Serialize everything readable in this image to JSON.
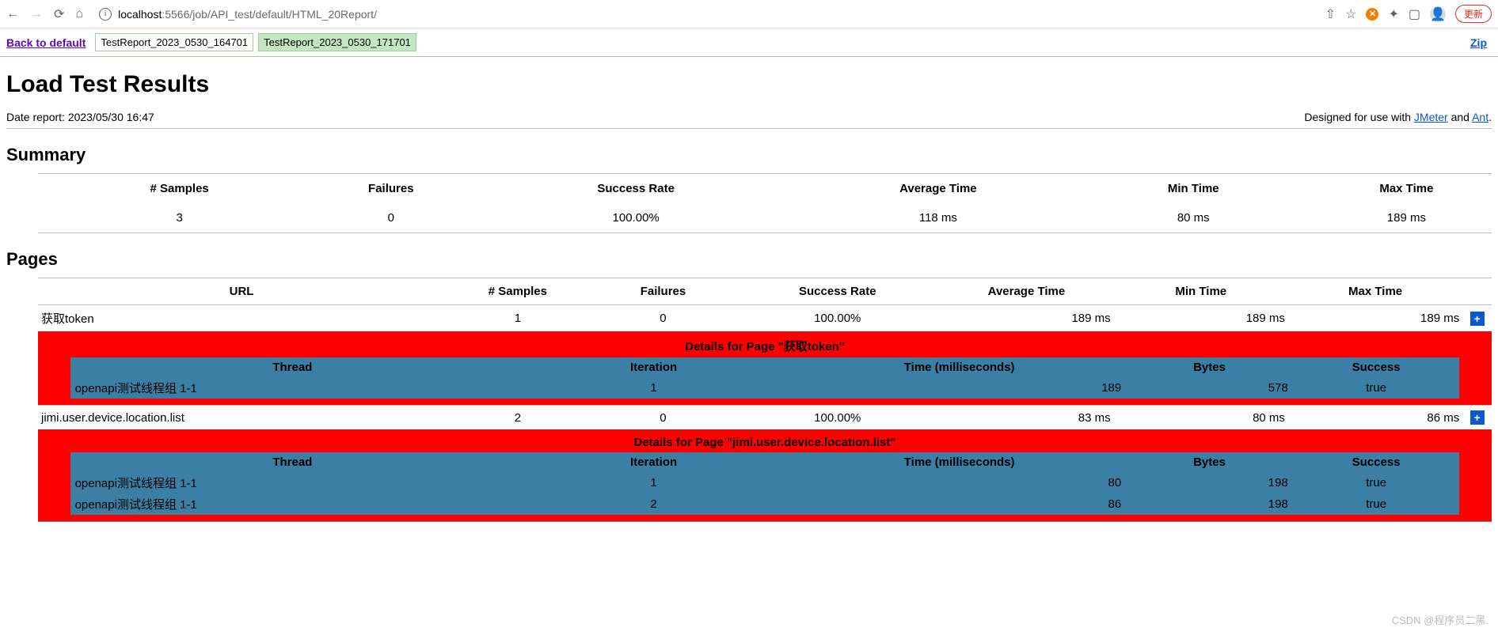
{
  "browser": {
    "url_host": "localhost",
    "url_port": ":5566",
    "url_path": "/job/API_test/default/HTML_20Report/",
    "update_btn": "更新"
  },
  "top": {
    "back": "Back to default",
    "tabs": [
      "TestReport_2023_0530_164701",
      "TestReport_2023_0530_171701"
    ],
    "zip": "Zip"
  },
  "title": "Load Test Results",
  "meta": {
    "date_label": "Date report: 2023/05/30 16:47",
    "designed_prefix": "Designed for use with ",
    "jmeter": "JMeter",
    "and": " and ",
    "ant": "Ant",
    "suffix": "."
  },
  "summary_heading": "Summary",
  "summary_headers": [
    "# Samples",
    "Failures",
    "Success Rate",
    "Average Time",
    "Min Time",
    "Max Time"
  ],
  "summary_row": [
    "3",
    "0",
    "100.00%",
    "118 ms",
    "80 ms",
    "189 ms"
  ],
  "pages_heading": "Pages",
  "pages_headers": [
    "URL",
    "# Samples",
    "Failures",
    "Success Rate",
    "Average Time",
    "Min Time",
    "Max Time"
  ],
  "pages": [
    {
      "url": "获取token",
      "samples": "1",
      "failures": "0",
      "rate": "100.00%",
      "avg": "189 ms",
      "min": "189 ms",
      "max": "189 ms",
      "details_title": "Details for Page \"获取token\"",
      "detail_headers": [
        "Thread",
        "Iteration",
        "Time (milliseconds)",
        "Bytes",
        "Success"
      ],
      "rows": [
        {
          "thread": "openapi测试线程组 1-1",
          "iter": "1",
          "time": "189",
          "bytes": "578",
          "success": "true"
        }
      ]
    },
    {
      "url": "jimi.user.device.location.list",
      "samples": "2",
      "failures": "0",
      "rate": "100.00%",
      "avg": "83 ms",
      "min": "80 ms",
      "max": "86 ms",
      "details_title": "Details for Page \"jimi.user.device.location.list\"",
      "detail_headers": [
        "Thread",
        "Iteration",
        "Time (milliseconds)",
        "Bytes",
        "Success"
      ],
      "rows": [
        {
          "thread": "openapi测试线程组 1-1",
          "iter": "1",
          "time": "80",
          "bytes": "198",
          "success": "true"
        },
        {
          "thread": "openapi测试线程组 1-1",
          "iter": "2",
          "time": "86",
          "bytes": "198",
          "success": "true"
        }
      ]
    }
  ],
  "watermark": "CSDN @程序员二黑."
}
